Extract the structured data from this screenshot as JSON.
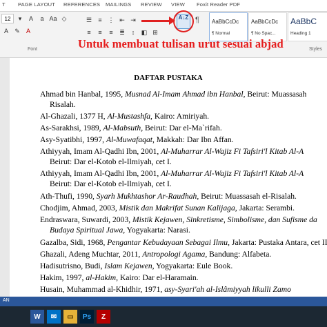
{
  "ribbon": {
    "tabs": [
      "T",
      "PAGE LAYOUT",
      "REFERENCES",
      "MAILINGS",
      "REVIEW",
      "VIEW",
      "Foxit Reader PDF"
    ],
    "font_size": "12",
    "sort_label": "A↓Z",
    "styles": [
      {
        "sample": "AaBbCcDc",
        "name": "¶ Normal"
      },
      {
        "sample": "AaBbCcDc",
        "name": "¶ No Spac..."
      },
      {
        "sample": "AaBbC",
        "name": "Heading 1"
      }
    ],
    "group_labels": [
      "Font",
      "Styles"
    ]
  },
  "annotation": "Untuk membuat tulisan urut sesuai abjad",
  "document": {
    "title": "DAFTAR PUSTAKA"
  },
  "status_text": "AN",
  "taskbar_icons": [
    "word-icon",
    "outlook-icon",
    "explorer-icon",
    "photoshop-icon",
    "filezilla-icon"
  ],
  "colors": {
    "annotation": "#e51d1d",
    "status_bar": "#2b579a",
    "taskbar": "#1c2833"
  }
}
